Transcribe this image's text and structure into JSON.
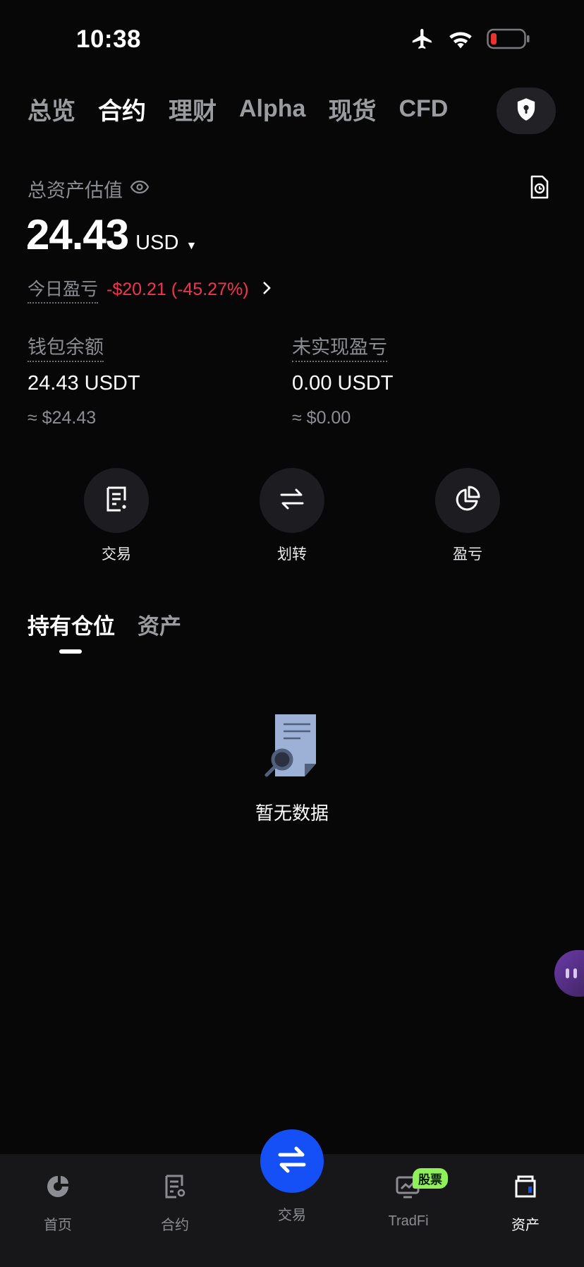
{
  "status_bar": {
    "time": "10:38",
    "icons": [
      "airplane-icon",
      "wifi-icon",
      "battery-low-icon"
    ],
    "battery_color": "#e8332f"
  },
  "top_tabs": [
    {
      "label": "总览",
      "active": false
    },
    {
      "label": "合约",
      "active": true
    },
    {
      "label": "理财",
      "active": false
    },
    {
      "label": "Alpha",
      "active": false
    },
    {
      "label": "现货",
      "active": false
    },
    {
      "label": "CFD",
      "active": false
    }
  ],
  "shield_button": {
    "icon": "shield-lock-icon"
  },
  "summary": {
    "label": "总资产估值",
    "eye_icon": "eye-icon",
    "history_icon": "document-clock-icon",
    "total": "24.43",
    "currency": "USD",
    "today_pnl_label": "今日盈亏",
    "today_pnl_value": "-$20.21 (-45.27%)",
    "pnl_color": "#f0344f"
  },
  "balances": {
    "wallet": {
      "label": "钱包余额",
      "value": "24.43 USDT",
      "approx": "≈ $24.43"
    },
    "unrealized": {
      "label": "未实现盈亏",
      "value": "0.00 USDT",
      "approx": "≈ $0.00"
    }
  },
  "actions": [
    {
      "label": "交易",
      "icon": "order-document-icon"
    },
    {
      "label": "划转",
      "icon": "transfer-arrows-icon"
    },
    {
      "label": "盈亏",
      "icon": "pie-chart-icon"
    }
  ],
  "position_tabs": [
    {
      "label": "持有仓位",
      "active": true
    },
    {
      "label": "资产",
      "active": false
    }
  ],
  "empty_state": {
    "text": "暂无数据",
    "icon": "document-search-icon"
  },
  "bottom_nav": {
    "items": [
      {
        "label": "首页",
        "icon": "home-logo-icon",
        "active": false
      },
      {
        "label": "合约",
        "icon": "contract-icon",
        "active": false
      },
      {
        "label": "交易",
        "icon": "trade-swap-icon",
        "active": false
      },
      {
        "label": "TradFi",
        "icon": "tradfi-chart-icon",
        "active": false,
        "badge": "股票"
      },
      {
        "label": "资产",
        "icon": "wallet-icon",
        "active": true
      }
    ],
    "accent_color": "#1450f5"
  }
}
